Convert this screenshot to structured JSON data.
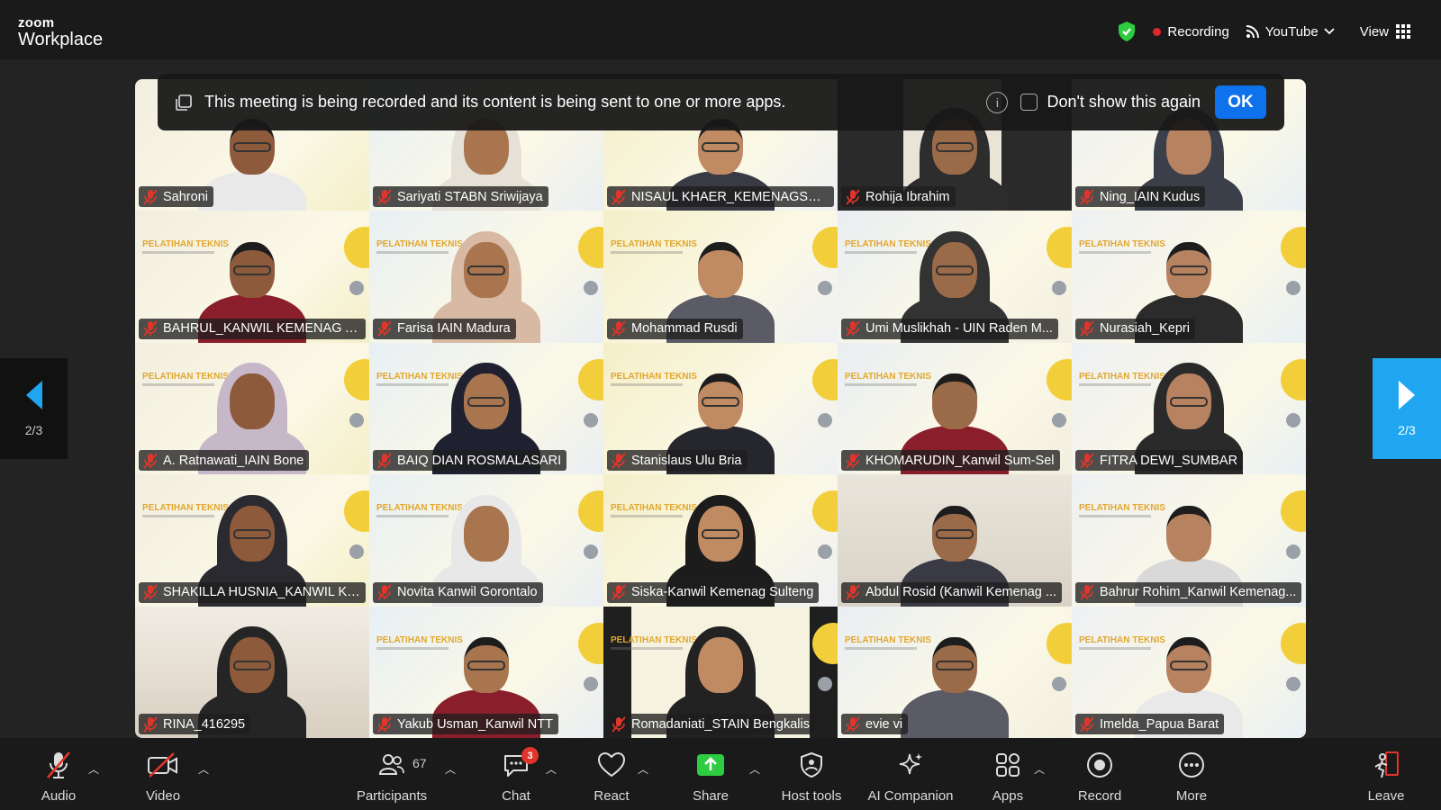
{
  "app": {
    "brand_top": "zoom",
    "brand_bottom": "Workplace"
  },
  "topbar": {
    "recording_label": "Recording",
    "stream_label": "YouTube",
    "view_label": "View"
  },
  "banner": {
    "message": "This meeting is being recorded and its content is being sent to one or more apps.",
    "checkbox_label": "Don't show this again",
    "ok_label": "OK"
  },
  "pagination": {
    "left_label": "2/3",
    "right_label": "2/3"
  },
  "participants": [
    {
      "name": "Sahroni"
    },
    {
      "name": "Sariyati STABN Sriwijaya"
    },
    {
      "name": "NISAUL KHAER_KEMENAGSULS..."
    },
    {
      "name": "Rohija Ibrahim"
    },
    {
      "name": "Ning_IAIN Kudus"
    },
    {
      "name": "BAHRUL_KANWIL KEMENAG A..."
    },
    {
      "name": "Farisa IAIN Madura"
    },
    {
      "name": "Mohammad Rusdi"
    },
    {
      "name": "Umi Muslikhah - UIN Raden M..."
    },
    {
      "name": "Nurasiah_Kepri"
    },
    {
      "name": "A. Ratnawati_IAIN Bone"
    },
    {
      "name": "BAIQ DIAN ROSMALASARI"
    },
    {
      "name": "Stanislaus Ulu Bria"
    },
    {
      "name": "KHOMARUDIN_Kanwil Sum-Sel"
    },
    {
      "name": "FITRA DEWI_SUMBAR"
    },
    {
      "name": "SHAKILLA HUSNIA_KANWIL KE..."
    },
    {
      "name": "Novita Kanwil Gorontalo"
    },
    {
      "name": "Siska-Kanwil Kemenag Sulteng"
    },
    {
      "name": "Abdul Rosid (Kanwil Kemenag ..."
    },
    {
      "name": "Bahrur Rohim_Kanwil Kemenag..."
    },
    {
      "name": "RINA_416295"
    },
    {
      "name": "Yakub Usman_Kanwil NTT"
    },
    {
      "name": "Romadaniati_STAIN Bengkalis"
    },
    {
      "name": "evie vi"
    },
    {
      "name": "Imelda_Papua Barat"
    }
  ],
  "slide": {
    "title": "PELATIHAN TEKNIS"
  },
  "toolbar": {
    "audio": "Audio",
    "video": "Video",
    "participants": "Participants",
    "participants_count": "67",
    "chat": "Chat",
    "chat_badge": "3",
    "react": "React",
    "share": "Share",
    "host_tools": "Host tools",
    "ai_companion": "AI Companion",
    "apps": "Apps",
    "record": "Record",
    "more": "More",
    "leave": "Leave"
  },
  "colors": {
    "accent": "#0e72ed",
    "recording": "#e02828",
    "nav_active": "#20a6f0",
    "shield": "#2ecc40",
    "share": "#2ecc40",
    "leave": "#e0352b"
  }
}
